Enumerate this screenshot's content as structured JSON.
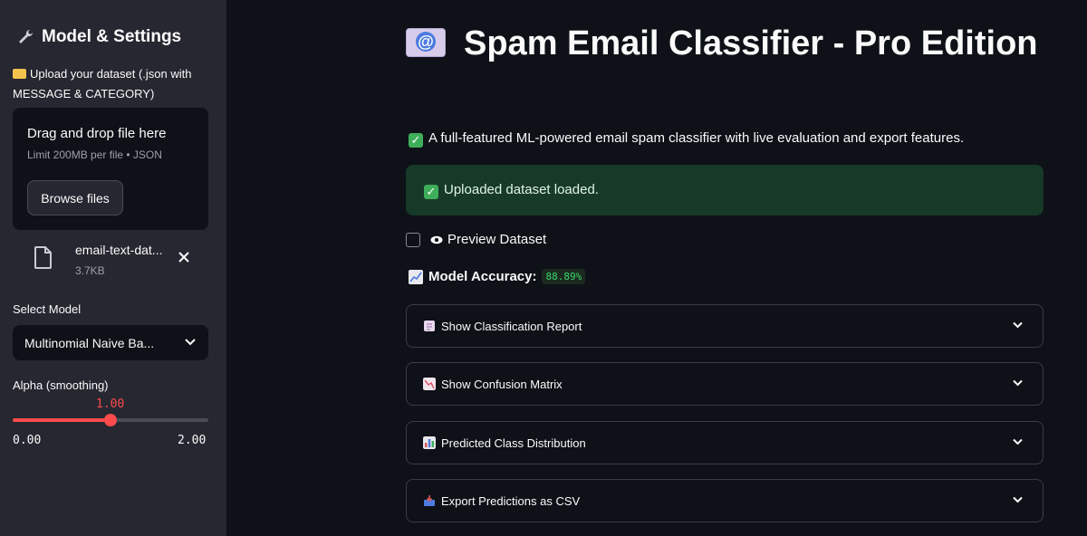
{
  "sidebar": {
    "title": "Model & Settings",
    "upload_label": "Upload your dataset (.json with MESSAGE & CATEGORY)",
    "dropzone": {
      "title": "Drag and drop file here",
      "limit": "Limit 200MB per file • JSON",
      "browse_label": "Browse files"
    },
    "file": {
      "name": "email-text-dat...",
      "size": "3.7KB"
    },
    "select_label": "Select Model",
    "selected_model": "Multinomial Naive Ba...",
    "slider": {
      "label": "Alpha (smoothing)",
      "value": "1.00",
      "min": "0.00",
      "max": "2.00",
      "fraction": 0.5
    }
  },
  "main": {
    "title": "Spam Email Classifier - Pro Edition",
    "subtitle": "A full-featured ML-powered email spam classifier with live evaluation and export features.",
    "success_message": "Uploaded dataset loaded.",
    "preview_label": "Preview Dataset",
    "accuracy_label": "Model Accuracy:",
    "accuracy_value": "88.89%",
    "expanders": [
      {
        "label": "Show Classification Report",
        "icon": "clipboard-icon"
      },
      {
        "label": "Show Confusion Matrix",
        "icon": "chart-down-icon"
      },
      {
        "label": "Predicted Class Distribution",
        "icon": "bar-chart-icon"
      },
      {
        "label": "Export Predictions as CSV",
        "icon": "inbox-tray-icon"
      }
    ]
  },
  "colors": {
    "accent": "#ff4b4b",
    "sidebar_bg": "#262730",
    "main_bg": "#0e1117",
    "success_bg": "#173928",
    "accuracy_green": "#3dd56d"
  }
}
